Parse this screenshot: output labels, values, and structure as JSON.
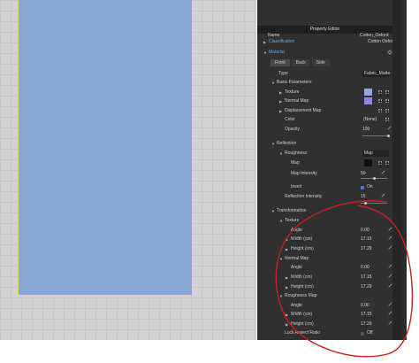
{
  "header": {
    "title": "Property Editor"
  },
  "top": {
    "name_label": "Name",
    "name_value": "Cotton_Oxford",
    "classification_label": "Classification",
    "classification_value": "Cotton Oxford",
    "material_label": "Material"
  },
  "tabs": [
    "Front",
    "Back",
    "Side"
  ],
  "type": {
    "label": "Type",
    "value": "Fabric_Matte"
  },
  "basic": {
    "label": "Basic Parameters",
    "texture": "Texture",
    "normal_map": "Normal Map",
    "displacement_map": "Displacement Map",
    "color": "Color",
    "color_value": "(None)",
    "opacity": "Opacity",
    "opacity_value": "100"
  },
  "reflection": {
    "label": "Reflection",
    "roughness": "Roughness",
    "roughness_value": "Map",
    "map": "Map",
    "map_intensity": "Map Intensity",
    "map_intensity_value": "50",
    "invert": "Invert",
    "invert_value": "On",
    "reflection_intensity": "Reflection Intensity",
    "reflection_intensity_value": "15"
  },
  "transformation": {
    "label": "Transformation",
    "groups": [
      {
        "name": "Texture",
        "angle": "Angle",
        "angle_value": "0.00",
        "width": "Width (cm)",
        "width_value": "17.15",
        "height": "Height (cm)",
        "height_value": "17.29"
      },
      {
        "name": "Normal Map",
        "angle": "Angle",
        "angle_value": "0.00",
        "width": "Width (cm)",
        "width_value": "17.15",
        "height": "Height (cm)",
        "height_value": "17.29"
      },
      {
        "name": "Roughness Map",
        "angle": "Angle",
        "angle_value": "0.00",
        "width": "Width (cm)",
        "width_value": "17.15",
        "height": "Height (cm)",
        "height_value": "17.29"
      }
    ],
    "lock_aspect": "Lock Aspect Ratio",
    "lock_aspect_value": "Off"
  },
  "colors": {
    "panel_bg": "#303030",
    "viewport_bg": "#d2d2d2",
    "object_fill": "#8aa6d6",
    "object_outline": "#e9df4e",
    "texture_swatch": "#8fa8de",
    "normal_swatch": "#8b85f0",
    "roughness_swatch": "#111111",
    "annotation": "#c8201f",
    "accent_link": "#6fa8e8"
  },
  "icons": [
    "expand-arrow-icon",
    "collapse-arrow-icon",
    "pin-icon",
    "grid-icon",
    "edit-icon",
    "checkbox-icon"
  ]
}
